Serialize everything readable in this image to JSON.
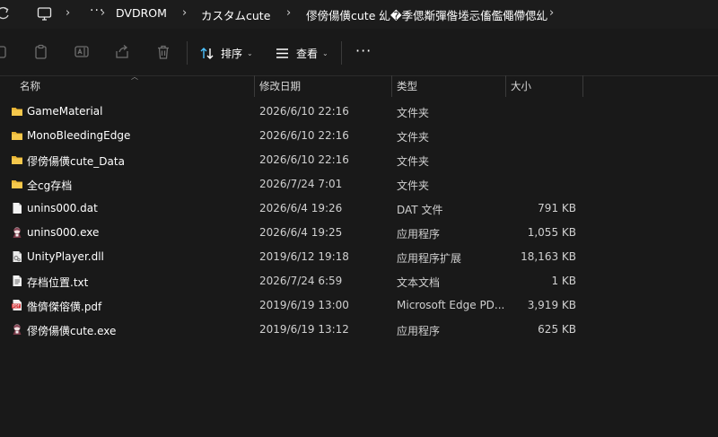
{
  "address": {
    "more": "···",
    "crumbs": [
      "DVDROM",
      "カスタムcute",
      "僇傍偒僙cute 乣�季偲斴彈偺堘忈傗儖僶僀偲乣"
    ]
  },
  "toolbar": {
    "sort_label": "排序",
    "view_label": "查看",
    "more": "···"
  },
  "columns": {
    "name": "名称",
    "date": "修改日期",
    "type": "类型",
    "size": "大小"
  },
  "files": [
    {
      "icon": "folder-icon",
      "name": "GameMaterial",
      "date": "2026/6/10 22:16",
      "type": "文件夹",
      "size": ""
    },
    {
      "icon": "folder-icon",
      "name": "MonoBleedingEdge",
      "date": "2026/6/10 22:16",
      "type": "文件夹",
      "size": ""
    },
    {
      "icon": "folder-icon",
      "name": "僇傍偒僙cute_Data",
      "date": "2026/6/10 22:16",
      "type": "文件夹",
      "size": ""
    },
    {
      "icon": "folder-icon",
      "name": "全cg存档",
      "date": "2026/7/24 7:01",
      "type": "文件夹",
      "size": ""
    },
    {
      "icon": "file-icon",
      "name": "unins000.dat",
      "date": "2026/6/4 19:26",
      "type": "DAT 文件",
      "size": "791 KB"
    },
    {
      "icon": "app-icon",
      "name": "unins000.exe",
      "date": "2026/6/4 19:25",
      "type": "应用程序",
      "size": "1,055 KB"
    },
    {
      "icon": "dll-icon",
      "name": "UnityPlayer.dll",
      "date": "2019/6/12 19:18",
      "type": "应用程序扩展",
      "size": "18,163 KB"
    },
    {
      "icon": "text-file-icon",
      "name": "存档位置.txt",
      "date": "2026/7/24 6:59",
      "type": "文本文档",
      "size": "1 KB"
    },
    {
      "icon": "pdf-icon",
      "name": "偺儕傑傛僙.pdf",
      "date": "2019/6/19 13:00",
      "type": "Microsoft Edge PD...",
      "size": "3,919 KB"
    },
    {
      "icon": "app-icon",
      "name": "僇傍偒僙cute.exe",
      "date": "2019/6/19 13:12",
      "type": "应用程序",
      "size": "625 KB"
    }
  ],
  "colors": {
    "background": "#191919",
    "folder": "#e8b434",
    "accent": "#4cc2ff",
    "pdf": "#d13438"
  }
}
